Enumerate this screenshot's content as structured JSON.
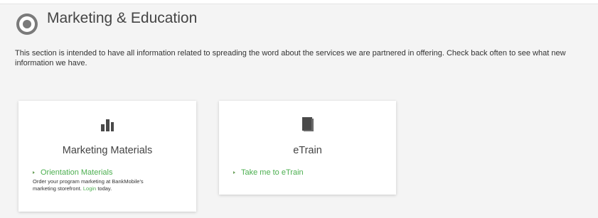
{
  "page": {
    "title": "Marketing & Education",
    "intro": "This section is intended to have all information related to spreading the word about the services we are partnered in offering. Check back often to see what new information we have."
  },
  "cards": [
    {
      "title": "Marketing Materials",
      "icon": "bar-chart-icon",
      "link_label": "Orientation Materials",
      "description_prefix": "Order your program marketing at BankMobile's marketing storefront.",
      "description_link": "Login",
      "description_suffix": "today."
    },
    {
      "title": "eTrain",
      "icon": "book-icon",
      "link_label": "Take me to eTrain"
    }
  ],
  "colors": {
    "link": "#4caf50",
    "icon": "#4a4a4a",
    "background": "#f4f4f4"
  }
}
